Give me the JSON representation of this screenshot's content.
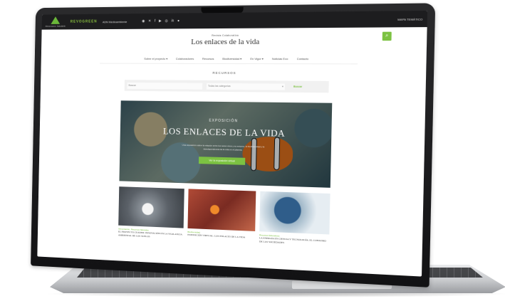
{
  "topbar": {
    "logo_text": "Alimentación Saludable",
    "brand2": "REVOGREEN",
    "link": "ADN Medioambiente",
    "socials": [
      "rss-icon",
      "x-icon",
      "facebook-icon",
      "youtube-icon",
      "instagram-icon",
      "linkedin-icon",
      "podcast-icon"
    ],
    "right_link": "MAPA TEMÁTICO"
  },
  "header": {
    "kicker": "Revista Colaborativa",
    "title": "Los enlaces de la vida",
    "search_icon": "search-icon"
  },
  "nav": {
    "items": [
      "Sobre el proyecto ▾",
      "Colaboradores",
      "Recursos",
      "Biodiversidad ▾",
      "En Vigor ▾",
      "Noticias Eco",
      "Contacto"
    ]
  },
  "section_label": "RECURSOS",
  "filters": {
    "search_placeholder": "Buscar",
    "category_placeholder": "Todas las categorías",
    "button": "Buscar"
  },
  "hero": {
    "kicker": "EXPOSICIÓN",
    "title": "LOS ENLACES DE LA VIDA",
    "description": "Una exposición sobre la relación entre los seres vivos y su entorno, la biodiversidad y la interdependencia de la vida en el planeta.",
    "cta": "Ver la exposición virtual"
  },
  "cards": [
    {
      "category": "Alimentación, Recursos Naturales",
      "title": "El proyecto Ceader: innovación en la vigilancia ambiental de los suelos"
    },
    {
      "category": "Biodiversidad",
      "title": "Exposición virtual: Los enlaces de la vida"
    },
    {
      "category": "Recursos Educativos",
      "title": "La energía en ciencia y tecnología: el consumo de las sociedades"
    }
  ]
}
